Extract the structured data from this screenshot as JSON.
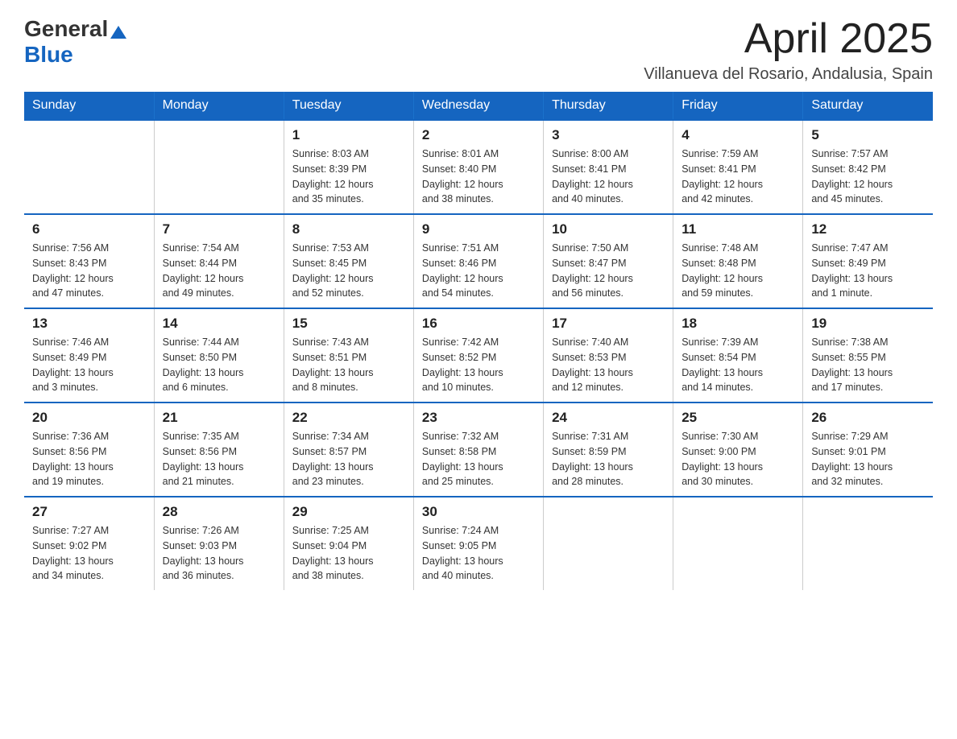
{
  "header": {
    "logo_general": "General",
    "logo_blue": "Blue",
    "month_title": "April 2025",
    "location": "Villanueva del Rosario, Andalusia, Spain"
  },
  "days_of_week": [
    "Sunday",
    "Monday",
    "Tuesday",
    "Wednesday",
    "Thursday",
    "Friday",
    "Saturday"
  ],
  "weeks": [
    [
      {
        "day": "",
        "info": ""
      },
      {
        "day": "",
        "info": ""
      },
      {
        "day": "1",
        "info": "Sunrise: 8:03 AM\nSunset: 8:39 PM\nDaylight: 12 hours\nand 35 minutes."
      },
      {
        "day": "2",
        "info": "Sunrise: 8:01 AM\nSunset: 8:40 PM\nDaylight: 12 hours\nand 38 minutes."
      },
      {
        "day": "3",
        "info": "Sunrise: 8:00 AM\nSunset: 8:41 PM\nDaylight: 12 hours\nand 40 minutes."
      },
      {
        "day": "4",
        "info": "Sunrise: 7:59 AM\nSunset: 8:41 PM\nDaylight: 12 hours\nand 42 minutes."
      },
      {
        "day": "5",
        "info": "Sunrise: 7:57 AM\nSunset: 8:42 PM\nDaylight: 12 hours\nand 45 minutes."
      }
    ],
    [
      {
        "day": "6",
        "info": "Sunrise: 7:56 AM\nSunset: 8:43 PM\nDaylight: 12 hours\nand 47 minutes."
      },
      {
        "day": "7",
        "info": "Sunrise: 7:54 AM\nSunset: 8:44 PM\nDaylight: 12 hours\nand 49 minutes."
      },
      {
        "day": "8",
        "info": "Sunrise: 7:53 AM\nSunset: 8:45 PM\nDaylight: 12 hours\nand 52 minutes."
      },
      {
        "day": "9",
        "info": "Sunrise: 7:51 AM\nSunset: 8:46 PM\nDaylight: 12 hours\nand 54 minutes."
      },
      {
        "day": "10",
        "info": "Sunrise: 7:50 AM\nSunset: 8:47 PM\nDaylight: 12 hours\nand 56 minutes."
      },
      {
        "day": "11",
        "info": "Sunrise: 7:48 AM\nSunset: 8:48 PM\nDaylight: 12 hours\nand 59 minutes."
      },
      {
        "day": "12",
        "info": "Sunrise: 7:47 AM\nSunset: 8:49 PM\nDaylight: 13 hours\nand 1 minute."
      }
    ],
    [
      {
        "day": "13",
        "info": "Sunrise: 7:46 AM\nSunset: 8:49 PM\nDaylight: 13 hours\nand 3 minutes."
      },
      {
        "day": "14",
        "info": "Sunrise: 7:44 AM\nSunset: 8:50 PM\nDaylight: 13 hours\nand 6 minutes."
      },
      {
        "day": "15",
        "info": "Sunrise: 7:43 AM\nSunset: 8:51 PM\nDaylight: 13 hours\nand 8 minutes."
      },
      {
        "day": "16",
        "info": "Sunrise: 7:42 AM\nSunset: 8:52 PM\nDaylight: 13 hours\nand 10 minutes."
      },
      {
        "day": "17",
        "info": "Sunrise: 7:40 AM\nSunset: 8:53 PM\nDaylight: 13 hours\nand 12 minutes."
      },
      {
        "day": "18",
        "info": "Sunrise: 7:39 AM\nSunset: 8:54 PM\nDaylight: 13 hours\nand 14 minutes."
      },
      {
        "day": "19",
        "info": "Sunrise: 7:38 AM\nSunset: 8:55 PM\nDaylight: 13 hours\nand 17 minutes."
      }
    ],
    [
      {
        "day": "20",
        "info": "Sunrise: 7:36 AM\nSunset: 8:56 PM\nDaylight: 13 hours\nand 19 minutes."
      },
      {
        "day": "21",
        "info": "Sunrise: 7:35 AM\nSunset: 8:56 PM\nDaylight: 13 hours\nand 21 minutes."
      },
      {
        "day": "22",
        "info": "Sunrise: 7:34 AM\nSunset: 8:57 PM\nDaylight: 13 hours\nand 23 minutes."
      },
      {
        "day": "23",
        "info": "Sunrise: 7:32 AM\nSunset: 8:58 PM\nDaylight: 13 hours\nand 25 minutes."
      },
      {
        "day": "24",
        "info": "Sunrise: 7:31 AM\nSunset: 8:59 PM\nDaylight: 13 hours\nand 28 minutes."
      },
      {
        "day": "25",
        "info": "Sunrise: 7:30 AM\nSunset: 9:00 PM\nDaylight: 13 hours\nand 30 minutes."
      },
      {
        "day": "26",
        "info": "Sunrise: 7:29 AM\nSunset: 9:01 PM\nDaylight: 13 hours\nand 32 minutes."
      }
    ],
    [
      {
        "day": "27",
        "info": "Sunrise: 7:27 AM\nSunset: 9:02 PM\nDaylight: 13 hours\nand 34 minutes."
      },
      {
        "day": "28",
        "info": "Sunrise: 7:26 AM\nSunset: 9:03 PM\nDaylight: 13 hours\nand 36 minutes."
      },
      {
        "day": "29",
        "info": "Sunrise: 7:25 AM\nSunset: 9:04 PM\nDaylight: 13 hours\nand 38 minutes."
      },
      {
        "day": "30",
        "info": "Sunrise: 7:24 AM\nSunset: 9:05 PM\nDaylight: 13 hours\nand 40 minutes."
      },
      {
        "day": "",
        "info": ""
      },
      {
        "day": "",
        "info": ""
      },
      {
        "day": "",
        "info": ""
      }
    ]
  ]
}
